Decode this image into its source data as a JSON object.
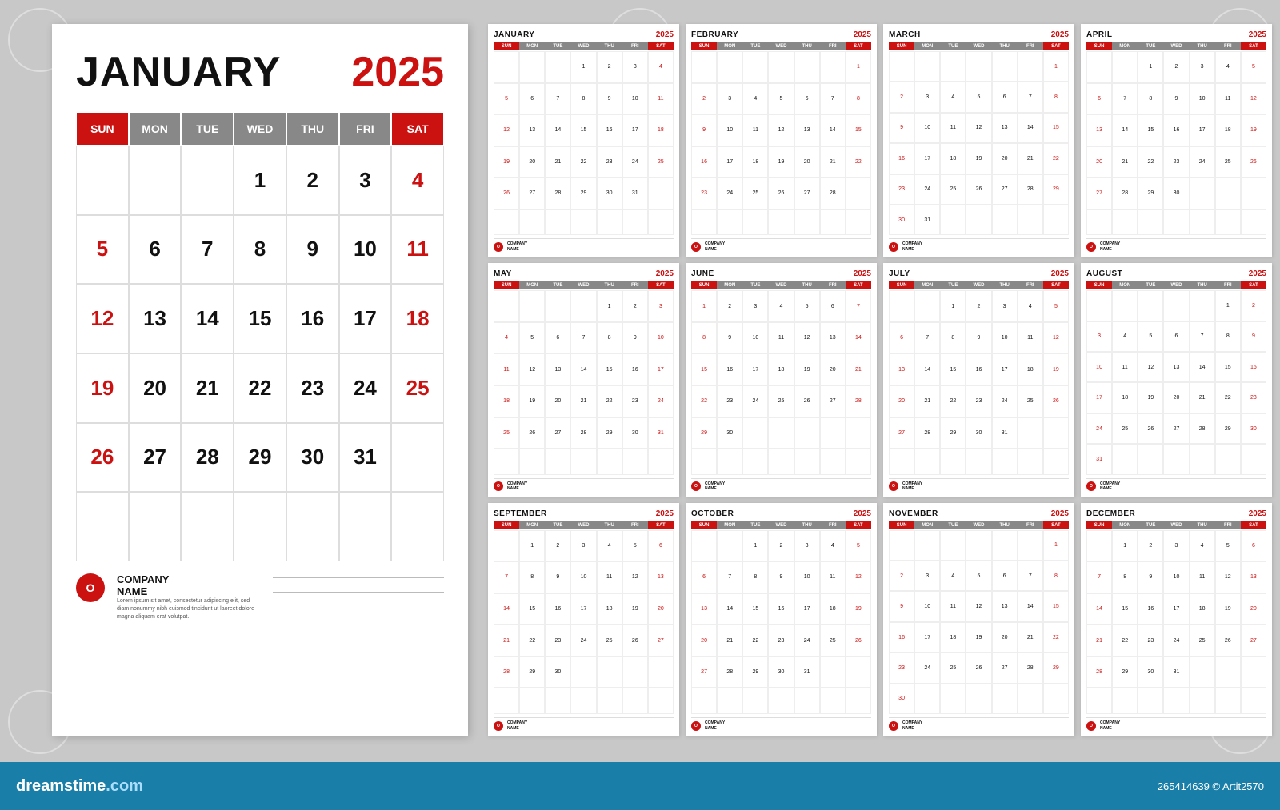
{
  "background_color": "#c8c8c8",
  "bottom_bar": {
    "logo": "dreamstime.com",
    "image_id": "265414639 © Artit2570"
  },
  "large_calendar": {
    "month": "JANUARY",
    "year": "2025",
    "day_headers": [
      "SUN",
      "MON",
      "TUE",
      "WED",
      "THU",
      "FRI",
      "SAT"
    ],
    "company": {
      "name": "COMPANY\nNAME",
      "description": "Lorem ipsum sit amet, consectetur adipiscing elit, sed diam nonummy nibh euismod tincidunt ut laoreet dolore magna aliquam erat volutpat."
    },
    "days": [
      {
        "d": "",
        "r": false
      },
      {
        "d": "",
        "r": false
      },
      {
        "d": "",
        "r": false
      },
      {
        "d": "1",
        "r": false
      },
      {
        "d": "2",
        "r": false
      },
      {
        "d": "3",
        "r": false
      },
      {
        "d": "4",
        "r": true
      },
      {
        "d": "5",
        "r": true
      },
      {
        "d": "6",
        "r": false
      },
      {
        "d": "7",
        "r": false
      },
      {
        "d": "8",
        "r": false
      },
      {
        "d": "9",
        "r": false
      },
      {
        "d": "10",
        "r": false
      },
      {
        "d": "11",
        "r": true
      },
      {
        "d": "12",
        "r": true
      },
      {
        "d": "13",
        "r": false
      },
      {
        "d": "14",
        "r": false
      },
      {
        "d": "15",
        "r": false
      },
      {
        "d": "16",
        "r": false
      },
      {
        "d": "17",
        "r": false
      },
      {
        "d": "18",
        "r": true
      },
      {
        "d": "19",
        "r": true
      },
      {
        "d": "20",
        "r": false
      },
      {
        "d": "21",
        "r": false
      },
      {
        "d": "22",
        "r": false
      },
      {
        "d": "23",
        "r": false
      },
      {
        "d": "24",
        "r": false
      },
      {
        "d": "25",
        "r": true
      },
      {
        "d": "26",
        "r": true
      },
      {
        "d": "27",
        "r": false
      },
      {
        "d": "28",
        "r": false
      },
      {
        "d": "29",
        "r": false
      },
      {
        "d": "30",
        "r": false
      },
      {
        "d": "31",
        "r": false
      },
      {
        "d": "",
        "r": false
      },
      {
        "d": "",
        "r": false
      },
      {
        "d": "",
        "r": false
      },
      {
        "d": "",
        "r": false
      },
      {
        "d": "",
        "r": false
      },
      {
        "d": "",
        "r": false
      },
      {
        "d": "",
        "r": false
      },
      {
        "d": "",
        "r": false
      }
    ]
  },
  "small_calendars": [
    {
      "month": "JANUARY",
      "year": "2025",
      "days": [
        "",
        "",
        "",
        "1",
        "2",
        "3",
        "4",
        "5",
        "6",
        "7",
        "8",
        "9",
        "10",
        "11",
        "12",
        "13",
        "14",
        "15",
        "16",
        "17",
        "18",
        "19",
        "20",
        "21",
        "22",
        "23",
        "24",
        "25",
        "26",
        "27",
        "28",
        "29",
        "30",
        "31",
        "",
        "",
        "",
        "",
        "",
        "",
        "",
        "",
        ""
      ],
      "reds": [
        3,
        6,
        10,
        13,
        17,
        20,
        24,
        27,
        31
      ]
    },
    {
      "month": "FEBRUARY",
      "year": "2025",
      "days": [
        "",
        "",
        "",
        "",
        "",
        "",
        "1",
        "2",
        "3",
        "4",
        "5",
        "6",
        "7",
        "8",
        "9",
        "10",
        "11",
        "12",
        "13",
        "14",
        "15",
        "16",
        "17",
        "18",
        "19",
        "20",
        "21",
        "22",
        "23",
        "24",
        "25",
        "26",
        "27",
        "28",
        "",
        "",
        "",
        "",
        "",
        "",
        "",
        ""
      ],
      "reds": [
        0,
        7,
        8,
        14,
        15,
        21,
        22,
        28
      ]
    },
    {
      "month": "MARCH",
      "year": "2025",
      "days": [
        "",
        "",
        "",
        "",
        "",
        "",
        "1",
        "2",
        "3",
        "4",
        "5",
        "6",
        "7",
        "8",
        "9",
        "10",
        "11",
        "12",
        "13",
        "14",
        "15",
        "16",
        "17",
        "18",
        "19",
        "20",
        "21",
        "22",
        "23",
        "24",
        "25",
        "26",
        "27",
        "28",
        "29",
        "30",
        "31",
        "",
        "",
        "",
        "",
        ""
      ],
      "reds": [
        0,
        6,
        7,
        13,
        14,
        20,
        21,
        27,
        28
      ]
    },
    {
      "month": "APRIL",
      "year": "2025",
      "days": [
        "",
        "",
        "1",
        "2",
        "3",
        "4",
        "5",
        "6",
        "7",
        "8",
        "9",
        "10",
        "11",
        "12",
        "13",
        "14",
        "15",
        "16",
        "17",
        "18",
        "19",
        "20",
        "21",
        "22",
        "23",
        "24",
        "25",
        "26",
        "27",
        "28",
        "29",
        "30",
        "",
        "",
        "",
        "",
        "",
        "",
        "",
        "",
        "",
        ""
      ],
      "reds": [
        4,
        5,
        11,
        12,
        18,
        19,
        25,
        26
      ]
    },
    {
      "month": "MAY",
      "year": "2025",
      "days": [
        "",
        "",
        "",
        "",
        "1",
        "2",
        "3",
        "4",
        "5",
        "6",
        "7",
        "8",
        "9",
        "10",
        "11",
        "12",
        "13",
        "14",
        "15",
        "16",
        "17",
        "18",
        "19",
        "20",
        "21",
        "22",
        "23",
        "24",
        "25",
        "26",
        "27",
        "28",
        "29",
        "30",
        "31",
        "",
        "",
        "",
        "",
        "",
        "",
        ""
      ],
      "reds": [
        2,
        3,
        9,
        10,
        16,
        17,
        23,
        24,
        30,
        31
      ]
    },
    {
      "month": "JUNE",
      "year": "2025",
      "days": [
        "1",
        "2",
        "3",
        "4",
        "5",
        "6",
        "7",
        "8",
        "9",
        "10",
        "11",
        "12",
        "13",
        "14",
        "15",
        "16",
        "17",
        "18",
        "19",
        "20",
        "21",
        "22",
        "23",
        "24",
        "25",
        "26",
        "27",
        "28",
        "29",
        "30",
        "",
        "",
        "",
        "",
        "",
        "",
        "",
        "",
        "",
        "",
        "",
        ""
      ],
      "reds": [
        0,
        6,
        7,
        13,
        14,
        20,
        21,
        27,
        28
      ]
    },
    {
      "month": "JULY",
      "year": "2025",
      "days": [
        "",
        "",
        "1",
        "2",
        "3",
        "4",
        "5",
        "6",
        "7",
        "8",
        "9",
        "10",
        "11",
        "12",
        "13",
        "14",
        "15",
        "16",
        "17",
        "18",
        "19",
        "20",
        "21",
        "22",
        "23",
        "24",
        "25",
        "26",
        "27",
        "28",
        "29",
        "30",
        "31",
        "",
        "",
        "",
        "",
        "",
        "",
        "",
        "",
        ""
      ],
      "reds": [
        4,
        5,
        11,
        12,
        18,
        19,
        25,
        26
      ]
    },
    {
      "month": "AUGUST",
      "year": "2025",
      "days": [
        "",
        "",
        "",
        "",
        "",
        "1",
        "2",
        "3",
        "4",
        "5",
        "6",
        "7",
        "8",
        "9",
        "10",
        "11",
        "12",
        "13",
        "14",
        "15",
        "16",
        "17",
        "18",
        "19",
        "20",
        "21",
        "22",
        "23",
        "24",
        "25",
        "26",
        "27",
        "28",
        "29",
        "30",
        "31",
        "",
        "",
        "",
        "",
        "",
        ""
      ],
      "reds": [
        1,
        2,
        8,
        9,
        15,
        16,
        22,
        23,
        29,
        30
      ]
    },
    {
      "month": "SEPTEMBER",
      "year": "2025",
      "days": [
        "",
        "1",
        "2",
        "3",
        "4",
        "5",
        "6",
        "7",
        "8",
        "9",
        "10",
        "11",
        "12",
        "13",
        "14",
        "15",
        "16",
        "17",
        "18",
        "19",
        "20",
        "21",
        "22",
        "23",
        "24",
        "25",
        "26",
        "27",
        "28",
        "29",
        "30",
        "",
        "",
        "",
        "",
        "",
        "",
        "",
        "",
        "",
        "",
        ""
      ],
      "reds": [
        0,
        5,
        6,
        12,
        13,
        19,
        20,
        26,
        27
      ]
    },
    {
      "month": "OCTOBER",
      "year": "2025",
      "days": [
        "",
        "",
        "1",
        "2",
        "3",
        "4",
        "5",
        "6",
        "7",
        "8",
        "9",
        "10",
        "11",
        "12",
        "13",
        "14",
        "15",
        "16",
        "17",
        "18",
        "19",
        "20",
        "21",
        "22",
        "23",
        "24",
        "25",
        "26",
        "27",
        "28",
        "29",
        "30",
        "31",
        "",
        "",
        "",
        "",
        "",
        "",
        "",
        "",
        ""
      ],
      "reds": [
        4,
        5,
        11,
        12,
        18,
        19,
        25,
        26
      ]
    },
    {
      "month": "NOVEMBER",
      "year": "2025",
      "days": [
        "",
        "",
        "",
        "",
        "",
        "",
        "1",
        "2",
        "3",
        "4",
        "5",
        "6",
        "7",
        "8",
        "9",
        "10",
        "11",
        "12",
        "13",
        "14",
        "15",
        "16",
        "17",
        "18",
        "19",
        "20",
        "21",
        "22",
        "23",
        "24",
        "25",
        "26",
        "27",
        "28",
        "29",
        "30",
        "",
        "",
        "",
        "",
        "",
        "",
        "",
        ""
      ],
      "reds": [
        0,
        6,
        7,
        13,
        14,
        20,
        21,
        27,
        28
      ]
    },
    {
      "month": "DECEMBER",
      "year": "2025",
      "days": [
        "",
        "1",
        "2",
        "3",
        "4",
        "5",
        "6",
        "7",
        "8",
        "9",
        "10",
        "11",
        "12",
        "13",
        "14",
        "15",
        "16",
        "17",
        "18",
        "19",
        "20",
        "21",
        "22",
        "23",
        "24",
        "25",
        "26",
        "27",
        "28",
        "29",
        "30",
        "31",
        "",
        "",
        "",
        "",
        "",
        "",
        "",
        "",
        "",
        ""
      ],
      "reds": [
        0,
        5,
        6,
        12,
        13,
        19,
        20,
        26,
        27
      ]
    }
  ]
}
